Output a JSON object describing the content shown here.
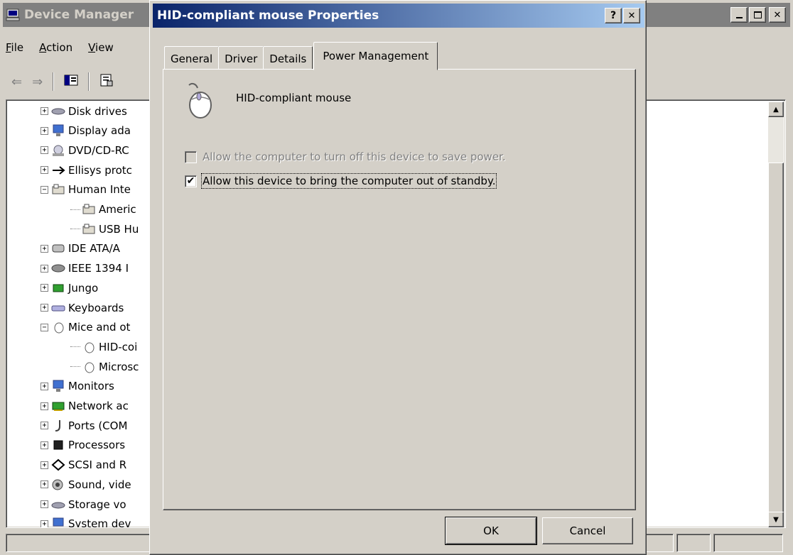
{
  "device_manager": {
    "title": "Device Manager",
    "menu": [
      {
        "label": "File",
        "accel": "F",
        "rest": "ile"
      },
      {
        "label": "Action",
        "accel": "A",
        "rest": "ction"
      },
      {
        "label": "View",
        "accel": "V",
        "rest": "iew"
      }
    ],
    "tree": [
      {
        "label": "Disk drives",
        "icon": "disk-drive-icon",
        "expander": "+",
        "level": 1
      },
      {
        "label": "Display ada",
        "icon": "monitor-icon",
        "expander": "+",
        "level": 1
      },
      {
        "label": "DVD/CD-RC",
        "icon": "cd-drive-icon",
        "expander": "+",
        "level": 1
      },
      {
        "label": "Ellisys protc",
        "icon": "usb-icon",
        "expander": "+",
        "level": 1
      },
      {
        "label": "Human Inte",
        "icon": "hid-icon",
        "expander": "−",
        "level": 1
      },
      {
        "label": "Americ",
        "icon": "hid-icon",
        "expander": "",
        "level": 2
      },
      {
        "label": "USB Hu",
        "icon": "hid-icon",
        "expander": "",
        "level": 2
      },
      {
        "label": "IDE ATA/A",
        "icon": "ide-controller-icon",
        "expander": "+",
        "level": 1
      },
      {
        "label": "IEEE 1394 I",
        "icon": "ieee1394-icon",
        "expander": "+",
        "level": 1
      },
      {
        "label": "Jungo",
        "icon": "chip-icon",
        "expander": "+",
        "level": 1
      },
      {
        "label": "Keyboards",
        "icon": "keyboard-icon",
        "expander": "+",
        "level": 1
      },
      {
        "label": "Mice and ot",
        "icon": "mouse-icon",
        "expander": "−",
        "level": 1
      },
      {
        "label": "HID-coi",
        "icon": "mouse-icon",
        "expander": "",
        "level": 2
      },
      {
        "label": "Microsc",
        "icon": "mouse-icon",
        "expander": "",
        "level": 2
      },
      {
        "label": "Monitors",
        "icon": "monitor-icon",
        "expander": "+",
        "level": 1
      },
      {
        "label": "Network ac",
        "icon": "network-adapter-icon",
        "expander": "+",
        "level": 1
      },
      {
        "label": "Ports (COM",
        "icon": "port-icon",
        "expander": "+",
        "level": 1
      },
      {
        "label": "Processors",
        "icon": "processor-icon",
        "expander": "+",
        "level": 1
      },
      {
        "label": "SCSI and R",
        "icon": "scsi-icon",
        "expander": "+",
        "level": 1
      },
      {
        "label": "Sound, vide",
        "icon": "sound-icon",
        "expander": "+",
        "level": 1
      },
      {
        "label": "Storage vo",
        "icon": "storage-icon",
        "expander": "+",
        "level": 1
      },
      {
        "label": "System dev",
        "icon": "system-device-icon",
        "expander": "+",
        "level": 1
      }
    ]
  },
  "dialog": {
    "title": "HID-compliant mouse Properties",
    "help_glyph": "?",
    "close_glyph": "✕",
    "tabs": [
      "General",
      "Driver",
      "Details",
      "Power Management"
    ],
    "active_tab": "Power Management",
    "device_name": "HID-compliant mouse",
    "options": [
      {
        "label": "Allow the computer to turn off this device to save power.",
        "checked": false,
        "enabled": false
      },
      {
        "label": "Allow this device to bring the computer out of standby.",
        "checked": true,
        "enabled": true
      }
    ],
    "ok_label": "OK",
    "cancel_label": "Cancel"
  }
}
